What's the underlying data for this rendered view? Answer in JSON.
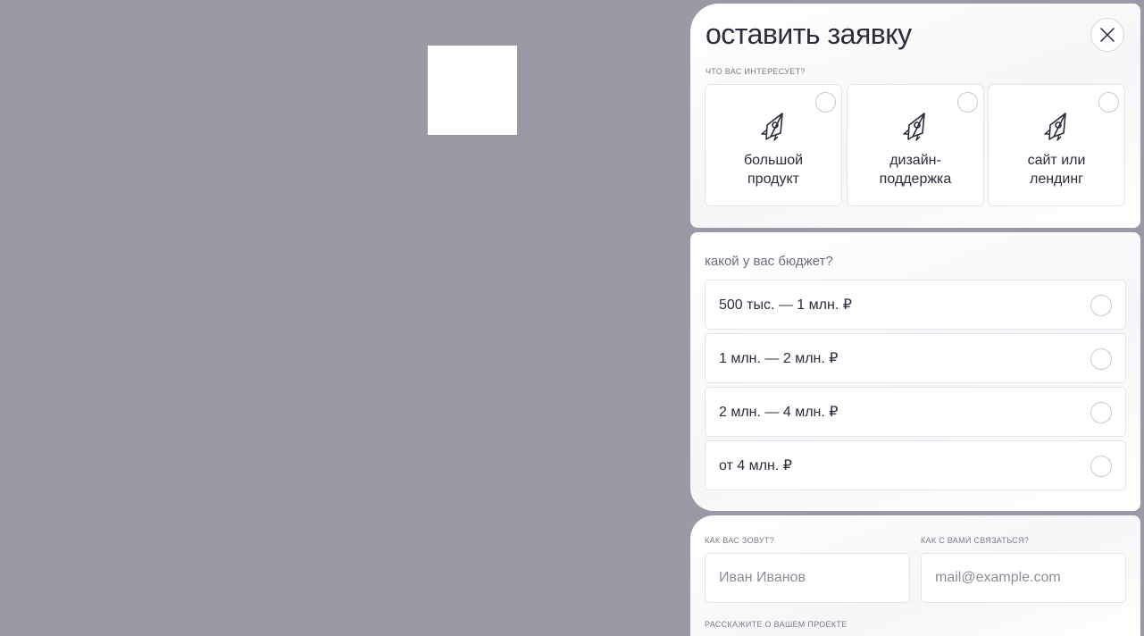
{
  "form": {
    "title": "оставить заявку",
    "close_icon": "close-icon",
    "interest": {
      "label": "ЧТО ВАС ИНТЕРЕСУЕТ?",
      "icon": "rocket-icon",
      "options": [
        {
          "label": "большой\nпродукт"
        },
        {
          "label": "дизайн-\nподдержка"
        },
        {
          "label": "сайт или\nлендинг"
        }
      ]
    },
    "budget": {
      "title": "какой у вас бюджет?",
      "options": [
        {
          "label": "500 тыс. — 1 млн. ₽"
        },
        {
          "label": "1 млн. — 2 млн. ₽"
        },
        {
          "label": "2 млн. — 4 млн. ₽"
        },
        {
          "label": "от 4 млн. ₽"
        }
      ]
    },
    "contact": {
      "name_label": "КАК ВАС ЗОВУТ?",
      "name_placeholder": "Иван Иванов",
      "contact_label": "КАК С ВАМИ СВЯЗАТЬСЯ?",
      "contact_placeholder": "mail@example.com",
      "project_label": "РАССКАЖИТЕ О ВАШЕМ ПРОЕКТЕ"
    }
  },
  "colors": {
    "overlay": "#9a99a5",
    "text": "#2c2c3a",
    "border": "#e4e4ea"
  }
}
